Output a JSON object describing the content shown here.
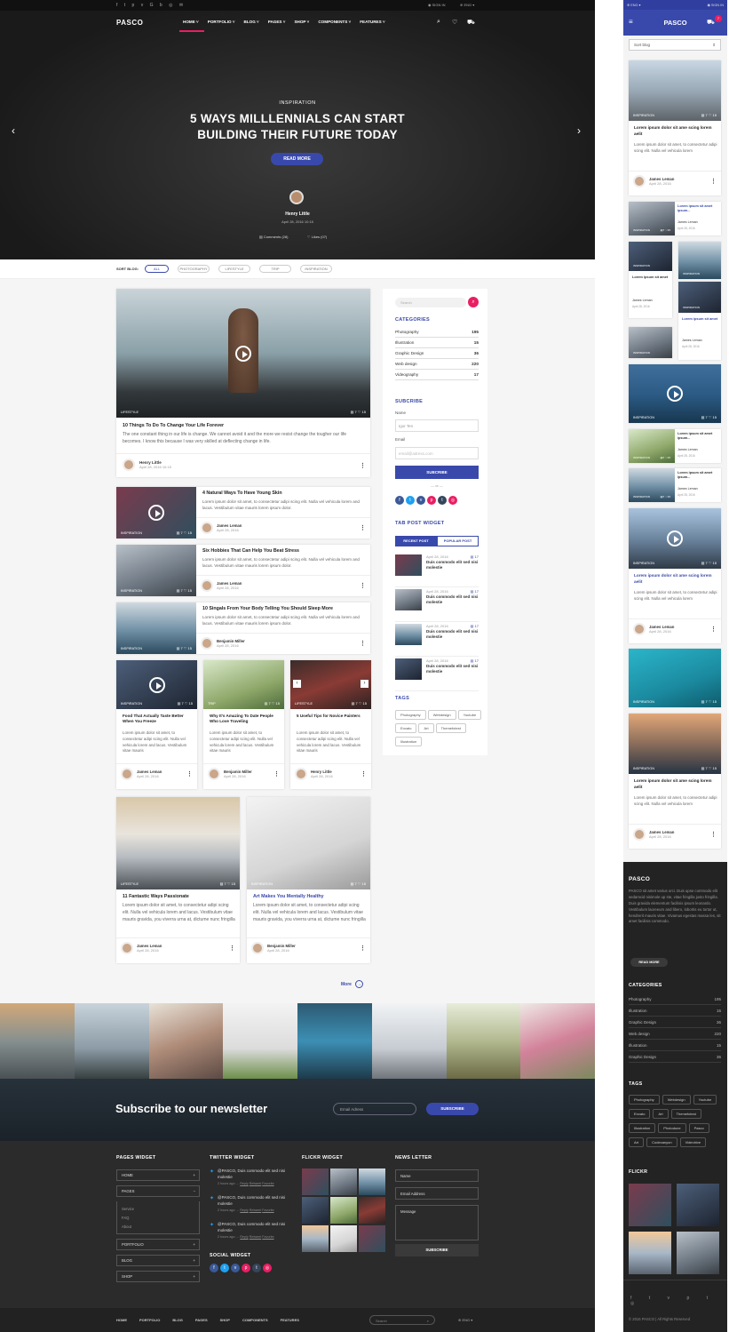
{
  "colors": {
    "accent": "#3949ab",
    "pink": "#e91e63",
    "dark": "#222",
    "footer": "#2a2a2a"
  },
  "topbar": {
    "signin": "SIGN IN",
    "lang": "ENG"
  },
  "brand": "PASCO",
  "nav": [
    "HOME",
    "PORTFOLIO",
    "BLOG",
    "PAGES",
    "SHOP",
    "COMPONENTS",
    "FEATURES"
  ],
  "hero": {
    "kicker": "INSPIRATION",
    "title1": "5 WAYS MILLLENNIALS CAN START",
    "title2": "BUILDING THEIR FUTURE TODAY",
    "button": "READ MORE",
    "author": "Henry Little",
    "date": "April 28, 2016",
    "time": "10:15",
    "comments": "Comments (28)",
    "likes": "Likes (07)"
  },
  "sort": {
    "label": "SORT BLOG:",
    "items": [
      "ALL",
      "PHOTOGRAPHY",
      "LIFESTYLE",
      "TRIP",
      "INSPIRATION"
    ]
  },
  "feat": {
    "badge": "LIFESTYLE",
    "c": "7",
    "l": "15",
    "title": "10 Things To Do To Change Your Life Forever",
    "text": "The one constant thing in our life is change. We cannot avoid it and the more we resist change the tougher our life becomes. I know this because I was very skilled at deflecting change in life.",
    "author": "Henry Little",
    "date": "April 28, 2016",
    "time": "10:15"
  },
  "rows": [
    {
      "badge": "INSPIRATION",
      "title": "4 Natural Ways To Have Young Skin",
      "text": "Lorem ipsum dolor sit amet, to consectetur adipi scing elit. Nulla vel vehicula lorem and lacus. Vestibulum vitae mauris lorem ipsum dolor.",
      "author": "James Leman",
      "date": "April 28, 2016"
    },
    {
      "badge": "INSPIRATION",
      "title": "Six Hobbies That Can Help You Beat Stress",
      "text": "Lorem ipsum dolor sit amet, to consectetur adipi scing elit. Nulla vel vehicula lorem and lacus. Vestibulum vitae mauris lorem ipsum dolor.",
      "author": "James Leman",
      "date": "April 28, 2016"
    },
    {
      "badge": "INSPIRATION",
      "title": "10 Singals From Your Body Telling You Should Sleep More",
      "text": "Lorem ipsum dolor sit amet, to consectetur adipi scing elit. Nulla vel vehicula lorem and lacus. Vestibulum vitae mauris lorem ipsum dolor.",
      "author": "Benjamin Miller",
      "date": "April 28, 2016"
    }
  ],
  "cols3": [
    {
      "badge": "INSPIRATION",
      "title": "Food That Actually Taste Better When You Freeze",
      "text": "Lorem ipsum dolor sit amet, to consectetur adipi scing elit. Nulla vel vehicula lorem and lacus. Vestibulum vitae mauris",
      "author": "James Leman",
      "date": "April 28, 2016"
    },
    {
      "badge": "TRIP",
      "title": "Why It's Amazing To Date People Who Love Traveling",
      "text": "Lorem ipsum dolor sit amet, to consectetur adipi scing elit. Nulla vel vehicula lorem and lacus. Vestibulum vitae mauris",
      "author": "Benjamin Miller",
      "date": "April 28, 2016"
    },
    {
      "badge": "LIFESTYLE",
      "title": "5 Useful Tips for Novice Painters",
      "text": "Lorem ipsum dolor sit amet, to consectetur adipi scing elit. Nulla vel vehicula lorem and lacus. Vestibulum vitae mauris",
      "author": "Henry Little",
      "date": "April 28, 2016"
    }
  ],
  "cols2": [
    {
      "badge": "LIFESTYLE",
      "title": "11 Fantastic Ways Passionate",
      "text": "Lorem ipsum dolor sit amet, to consectetur adipi scing elit. Nulla vel vehicula lorem and lacus. Vestibulum vitae mauris gravida, you viverra urna at, dictume nunc fringilla",
      "author": "James Leman",
      "date": "April 28, 2016"
    },
    {
      "badge": "INSPIRATION",
      "title": "Art Makes You Mentally Healthy",
      "text": "Lorem ipsum dolor sit amet, to consectetur adipi scing elit. Nulla vel vehicula lorem and lacus. Vestibulum vitae mauris gravida, you viverra urna at, dictume nunc fringilla",
      "author": "Benjamin Miller",
      "date": "April 28, 2016"
    }
  ],
  "more": "More",
  "side": {
    "search": "Search",
    "cat_h": "CATEGORIES",
    "cats": [
      [
        "Photography",
        "195"
      ],
      [
        "Illustration",
        "15"
      ],
      [
        "Graphic Design",
        "36"
      ],
      [
        "Web design",
        "220"
      ],
      [
        "Videography",
        "17"
      ]
    ],
    "sub_h": "SUBCRIBE",
    "name_l": "Name",
    "name_v": "Igor Ten",
    "email_l": "Email",
    "email_ph": "email@adress.com",
    "sub_btn": "SUBCRIBE",
    "or": "or",
    "tab_h": "TAB POST WIDGET",
    "tab1": "RECENT POST",
    "tab2": "POPULAR POST",
    "posts": [
      [
        "April 28, 2016",
        "Duis commodo elit sed nisi molestie",
        "17"
      ],
      [
        "April 28, 2016",
        "Duis commodo elit sed nisi molestie",
        "17"
      ],
      [
        "April 28, 2016",
        "Duis commodo elit sed nisi molestie",
        "17"
      ],
      [
        "April 28, 2016",
        "Duis commodo elit sed nisi molestie",
        "17"
      ]
    ],
    "tags_h": "TAGS",
    "tags": [
      "Photography",
      "Webdesign",
      "Youtube",
      "Envato",
      "Art",
      "Themefotest",
      "Illustration"
    ]
  },
  "news": {
    "title": "Subscribe to our newsletter",
    "ph": "Email Adress",
    "btn": "SUBSCRIBE"
  },
  "footer": {
    "pages_h": "PAGES WIDGET",
    "pages": [
      "HOME",
      "PAGES",
      "PORTFOLIO",
      "BLOG",
      "SHOP"
    ],
    "sub": [
      "Service",
      "FAQ",
      "About"
    ],
    "tw_h": "TWITTER WIDGET",
    "tweets": [
      "@PASCO, Duis commodo elit sed nisi molestie",
      "@PASCO, Duis commodo elit sed nisi molestie",
      "@PASCO, Duis commodo elit sed nisi molestie"
    ],
    "tw_meta": "2 hours ago",
    "tw_a": [
      "Reply",
      "Retweet",
      "Favorite"
    ],
    "social_h": "SOCIAL WIDGET",
    "fl_h": "FLICKR WIDGET",
    "nl_h": "NEWS LETTER",
    "nl_name": "Name",
    "nl_email": "Email Address",
    "nl_msg": "Message",
    "nl_btn": "SUBSCRIBE",
    "bottom": [
      "HOME",
      "PORTFOLIO",
      "BLOG",
      "PAGES",
      "SHOP",
      "COMPONENTS",
      "FEATURES"
    ],
    "search": "Search",
    "lang": "ENG"
  },
  "mob": {
    "lang": "ENG",
    "signin": "SIGN IN",
    "brand": "PASCO",
    "cart": "7",
    "sort": "Sort blog",
    "c": "7",
    "l": "15",
    "badge": "INSPIRATION",
    "title": "Lorem ipsum dolor sit ame scing lorem aelit",
    "text": "Lorem ipsum dolor sit amet, to consectetur adipi scing elit. Nulla vel vehicula lorem",
    "author": "James Leman",
    "date": "April 28, 2016",
    "short": "Lorem ipsum sit amet ipsum...",
    "short2": "Lorem ipsum sit amet",
    "about_h": "PASCO",
    "about": "PASCO sit amet varius orci. Duis upse commodo elit sedamcid nisimole up ste, vitae fringilla justo fringilla. Duis gravida elementum facilisis ipsum leonardo. Vestibulum laoreeum and libero, lobortis eu tortor ut, hendrerit mauris vitae. Vivamus egestas massa les, sit amet facilisis commodo.",
    "more": "READ MORE",
    "cat_h": "CATEGORIES",
    "cats": [
      [
        "Photography",
        "195"
      ],
      [
        "Illustration",
        "15"
      ],
      [
        "Graphic Design",
        "36"
      ],
      [
        "Web design",
        "220"
      ],
      [
        "Illustration",
        "15"
      ],
      [
        "Graphic Design",
        "36"
      ]
    ],
    "tags_h": "TAGS",
    "tags": [
      "Photography",
      "Webdesign",
      "Youtube",
      "Envato",
      "Art",
      "Themefotest",
      "Illustration",
      "Photodune",
      "Pasco",
      "Art",
      "Codecanyon",
      "Videohive"
    ],
    "flickr_h": "FLICKR",
    "copy": "© 2016 PASCO | All Rights Reserved"
  }
}
